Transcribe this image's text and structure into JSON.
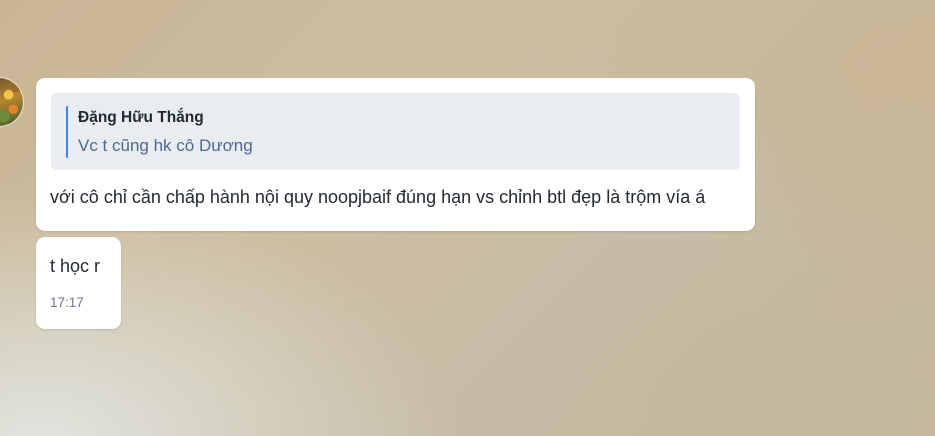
{
  "conversation": {
    "messages": [
      {
        "reply_to": {
          "author": "Đặng Hữu Thắng",
          "text": "Vc t cũng hk cô Dương"
        },
        "text": "với cô chỉ cần chấp hành nội quy noopjbaif đúng hạn vs chỉnh btl đẹp là trộm vía á"
      },
      {
        "text": "t học r",
        "time": "17:17"
      }
    ]
  },
  "colors": {
    "bubble_bg": "#ffffff",
    "quote_bg": "#e9edf1",
    "quote_accent": "#3b82f6",
    "quote_text": "#4a6a92",
    "message_text": "#222a33",
    "timestamp": "#6b7785"
  }
}
